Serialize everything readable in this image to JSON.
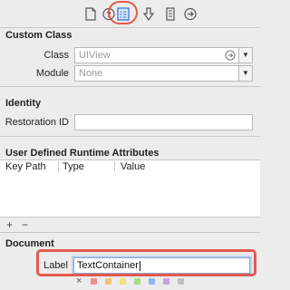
{
  "toolbar": {
    "icons": [
      "file-icon",
      "help-icon",
      "identity-icon",
      "attributes-icon",
      "size-icon",
      "connections-icon"
    ],
    "active_icon": "identity-icon",
    "highlight_color": "#e25a4e"
  },
  "custom_class": {
    "title": "Custom Class",
    "class_label": "Class",
    "class_value": "UIView",
    "module_label": "Module",
    "module_value": "None"
  },
  "identity": {
    "title": "Identity",
    "restoration_id_label": "Restoration ID",
    "restoration_id_value": ""
  },
  "runtime_attributes": {
    "title": "User Defined Runtime Attributes",
    "columns": [
      "Key Path",
      "Type",
      "Value"
    ],
    "add_label": "+",
    "remove_label": "−"
  },
  "document": {
    "title": "Document",
    "label_label": "Label",
    "label_value": "TextContainer",
    "clear_label": "×",
    "swatch_colors": [
      "#f08f8f",
      "#f5c078",
      "#f2e27a",
      "#a9dc86",
      "#87b6ef",
      "#c8a0e6",
      "#c0c0c0"
    ]
  }
}
